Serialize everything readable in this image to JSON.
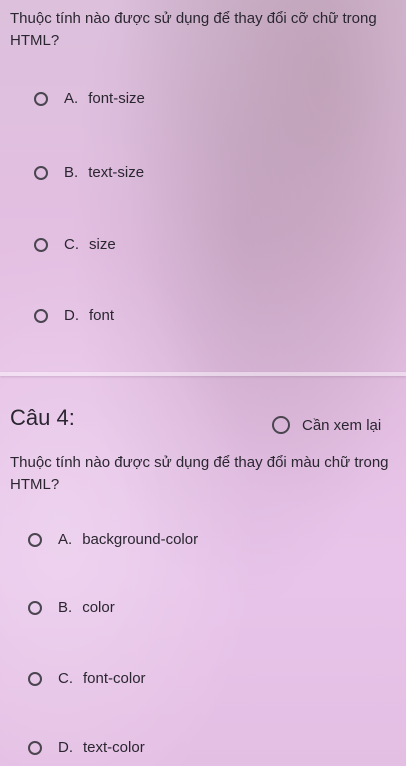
{
  "question3": {
    "text": "Thuộc tính nào được sử dụng để thay đổi cỡ chữ trong HTML?",
    "options": [
      {
        "letter": "A.",
        "label": "font-size"
      },
      {
        "letter": "B.",
        "label": "text-size"
      },
      {
        "letter": "C.",
        "label": "size"
      },
      {
        "letter": "D.",
        "label": "font"
      }
    ]
  },
  "question4": {
    "title": "Câu 4:",
    "review_label": "Cần xem lại",
    "text": "Thuộc tính nào được sử dụng để thay đổi màu chữ trong HTML?",
    "options": [
      {
        "letter": "A.",
        "label": "background-color"
      },
      {
        "letter": "B.",
        "label": "color"
      },
      {
        "letter": "C.",
        "label": "font-color"
      },
      {
        "letter": "D.",
        "label": "text-color"
      }
    ]
  }
}
